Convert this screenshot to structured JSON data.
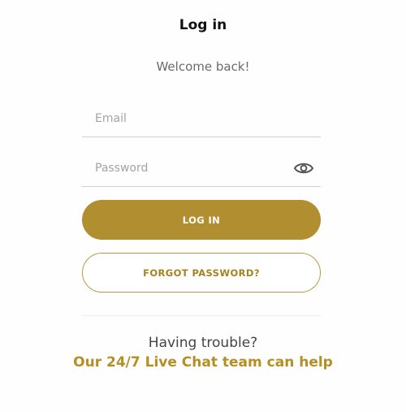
{
  "header": {
    "title": "Log in",
    "subtitle": "Welcome back!"
  },
  "form": {
    "email": {
      "value": "",
      "placeholder": "Email"
    },
    "password": {
      "value": "",
      "placeholder": "Password",
      "toggle_icon": "eye-icon"
    },
    "login_label": "LOG IN",
    "forgot_label": "FORGOT PASSWORD?"
  },
  "help": {
    "trouble_text": "Having trouble?",
    "link_text": "Our 24/7 Live Chat team can help"
  },
  "colors": {
    "accent": "#b18e2f",
    "accent_text": "#b58e24",
    "divider": "#ececec"
  }
}
